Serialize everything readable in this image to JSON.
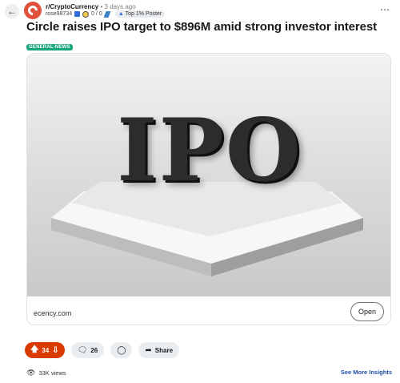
{
  "header": {
    "subreddit": "r/CryptoCurrency",
    "separator": "•",
    "time_ago": "3 days ago",
    "username": "rose98734",
    "karma": "0 / 0",
    "flair": "Top 1% Poster"
  },
  "post": {
    "title": "Circle raises IPO target to $896M amid strong investor interest",
    "tag": "GENERAL-NEWS",
    "image_text": "IPO",
    "link_domain": "ecency.com",
    "open_label": "Open"
  },
  "actions": {
    "votes": "34",
    "comments": "26",
    "share_label": "Share"
  },
  "footer": {
    "views": "33K views",
    "insights_label": "See More Insights"
  },
  "colors": {
    "upvote_active": "#d93a00",
    "tag_bg": "#17a57a",
    "avatar": "#e0513b",
    "link": "#1f4fa8"
  },
  "icons": [
    "back-arrow-icon",
    "subreddit-avatar-icon",
    "more-options-icon",
    "upvote-icon",
    "downvote-icon",
    "comment-icon",
    "award-icon",
    "share-icon",
    "views-icon"
  ]
}
